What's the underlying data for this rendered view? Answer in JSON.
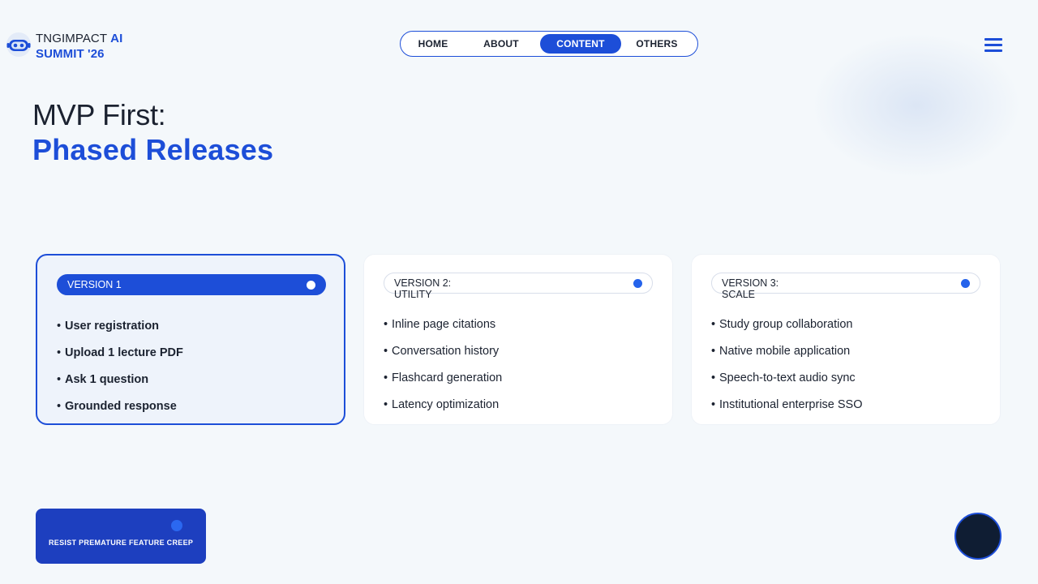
{
  "brand": {
    "name_part1": "TNGIMPACT",
    "name_accent": "AI",
    "name_line2": "SUMMIT '26",
    "logo_icon": "robot-icon"
  },
  "nav": {
    "items": [
      {
        "label": "HOME"
      },
      {
        "label": "ABOUT"
      },
      {
        "label": "CONTENT",
        "active": true
      },
      {
        "label": "OTHERS"
      }
    ]
  },
  "menu": {
    "icon": "hamburger-menu-icon"
  },
  "title": {
    "line1": "MVP First:",
    "line2": "Phased Releases"
  },
  "versions": [
    {
      "label": "VERSION 1",
      "sub": "",
      "active": true,
      "features": [
        "User registration",
        "Upload 1 lecture PDF",
        "Ask 1 question",
        "Grounded response"
      ]
    },
    {
      "label": "VERSION 2:",
      "sub": "UTILITY",
      "active": false,
      "features": [
        "Inline page citations",
        "Conversation history",
        "Flashcard generation",
        "Latency optimization"
      ]
    },
    {
      "label": "VERSION 3:",
      "sub": "SCALE",
      "active": false,
      "features": [
        "Study group collaboration",
        "Native mobile application",
        "Speech-to-text audio sync",
        "Institutional enterprise SSO"
      ]
    }
  ],
  "callout": {
    "text": "RESIST PREMATURE FEATURE CREEP"
  },
  "bullet": "•",
  "colors": {
    "accent": "#1d4ed8",
    "background": "#f4f8fb",
    "fab": "#0f1d33"
  }
}
